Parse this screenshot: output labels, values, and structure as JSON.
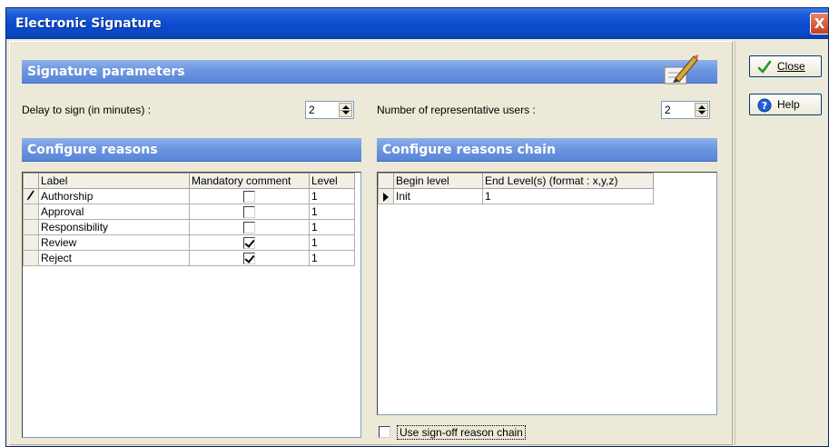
{
  "window": {
    "title": "Electronic Signature",
    "close_glyph": "X"
  },
  "sections": {
    "signature_parameters": "Signature parameters",
    "configure_reasons": "Configure reasons",
    "configure_reasons_chain": "Configure reasons chain"
  },
  "params": {
    "delay_label": "Delay to sign (in minutes) :",
    "delay_value": "2",
    "users_label": "Number of representative users :",
    "users_value": "2"
  },
  "reasons_table": {
    "columns": [
      "Label",
      "Mandatory comment",
      "Level"
    ],
    "rows": [
      {
        "label": "Authorship",
        "mandatory": false,
        "level": "1"
      },
      {
        "label": "Approval",
        "mandatory": false,
        "level": "1"
      },
      {
        "label": "Responsibility",
        "mandatory": false,
        "level": "1"
      },
      {
        "label": "Review",
        "mandatory": true,
        "level": "1"
      },
      {
        "label": "Reject",
        "mandatory": true,
        "level": "1"
      }
    ]
  },
  "chain_table": {
    "columns": [
      "Begin level",
      "End Level(s) (format : x,y,z)"
    ],
    "rows": [
      {
        "begin": "Init",
        "end": "1"
      }
    ]
  },
  "use_signoff_label": "Use sign-off reason chain",
  "buttons": {
    "close": "Close",
    "help": "Help"
  },
  "icons": {
    "pen": "pen-signature-icon",
    "edit_row": "pencil-edit-icon",
    "current_row": "row-pointer-icon",
    "close": "green-check-icon",
    "help": "help-question-icon"
  },
  "colors": {
    "title_bar": "#0a4bd0",
    "section_header": "#6d96e0",
    "dialog_bg": "#ece9d8"
  }
}
